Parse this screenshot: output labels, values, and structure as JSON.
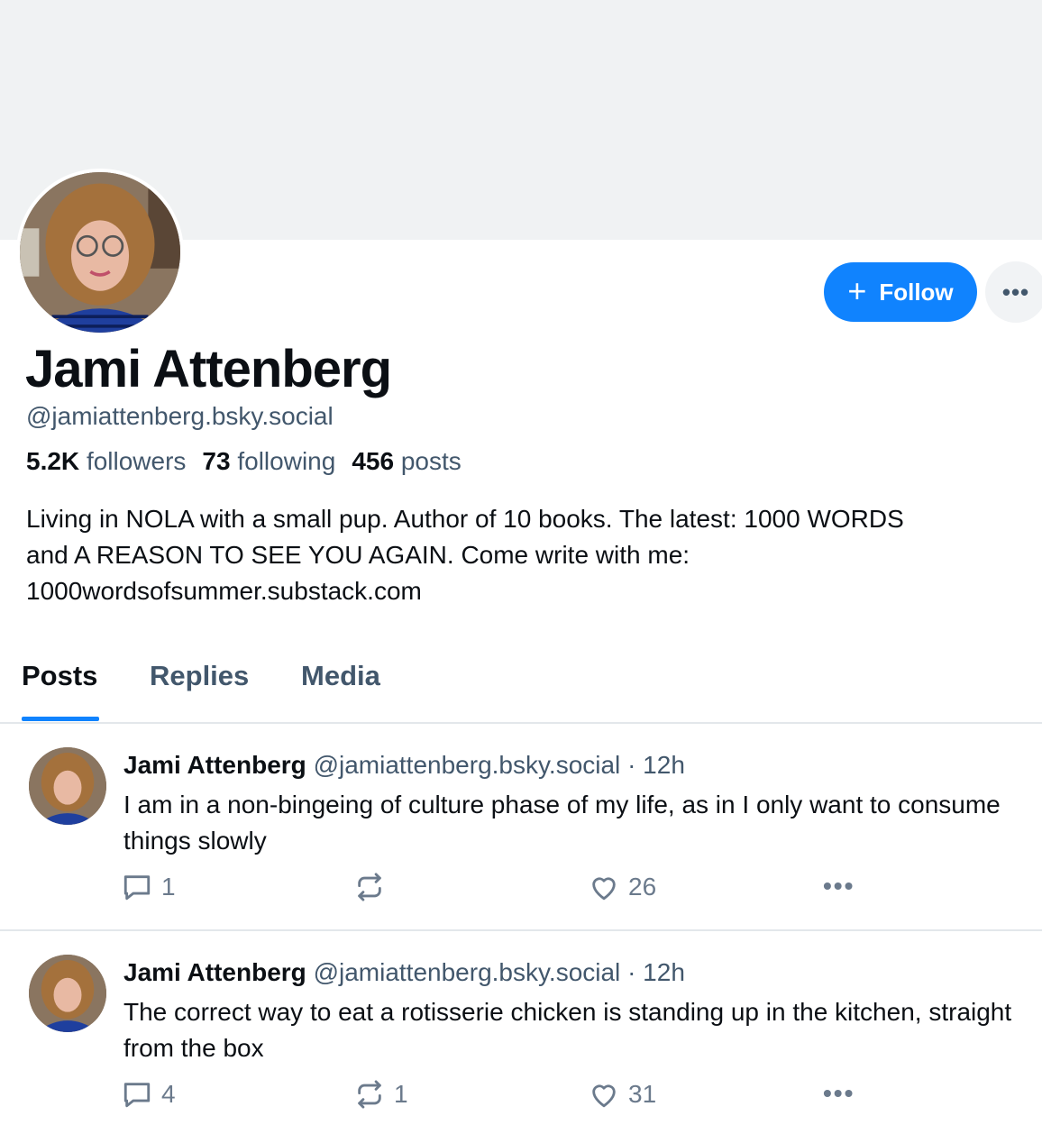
{
  "profile": {
    "display_name": "Jami Attenberg",
    "handle": "@jamiattenberg.bsky.social",
    "followers_count": "5.2K",
    "followers_label": "followers",
    "following_count": "73",
    "following_label": "following",
    "posts_count": "456",
    "posts_label": "posts",
    "bio": [
      "Living in NOLA with a small pup. Author of 10 books. The latest: 1000 WORDS",
      "and A REASON TO SEE YOU AGAIN. Come write with me:",
      "1000wordsofsummer.substack.com"
    ],
    "follow_label": "Follow",
    "more_label": "•••"
  },
  "tabs": [
    {
      "label": "Posts",
      "active": true
    },
    {
      "label": "Replies",
      "active": false
    },
    {
      "label": "Media",
      "active": false
    }
  ],
  "posts": [
    {
      "author": "Jami Attenberg",
      "handle": "@jamiattenberg.bsky.social",
      "time": "12h",
      "text": "I am in a non-bingeing of culture phase of my life, as in I only want to consume things slowly",
      "replies": "1",
      "reposts": "",
      "likes": "26"
    },
    {
      "author": "Jami Attenberg",
      "handle": "@jamiattenberg.bsky.social",
      "time": "12h",
      "text": "The correct way to eat a rotisserie chicken is standing up in the kitchen, straight from the box",
      "replies": "4",
      "reposts": "1",
      "likes": "31"
    }
  ],
  "colors": {
    "accent": "#1083fe",
    "banner": "#f0f2f3",
    "muted_text": "#42576c"
  },
  "icons": [
    "plus-icon",
    "more-dots-icon",
    "reply-icon",
    "repost-icon",
    "like-icon",
    "post-menu-icon"
  ]
}
